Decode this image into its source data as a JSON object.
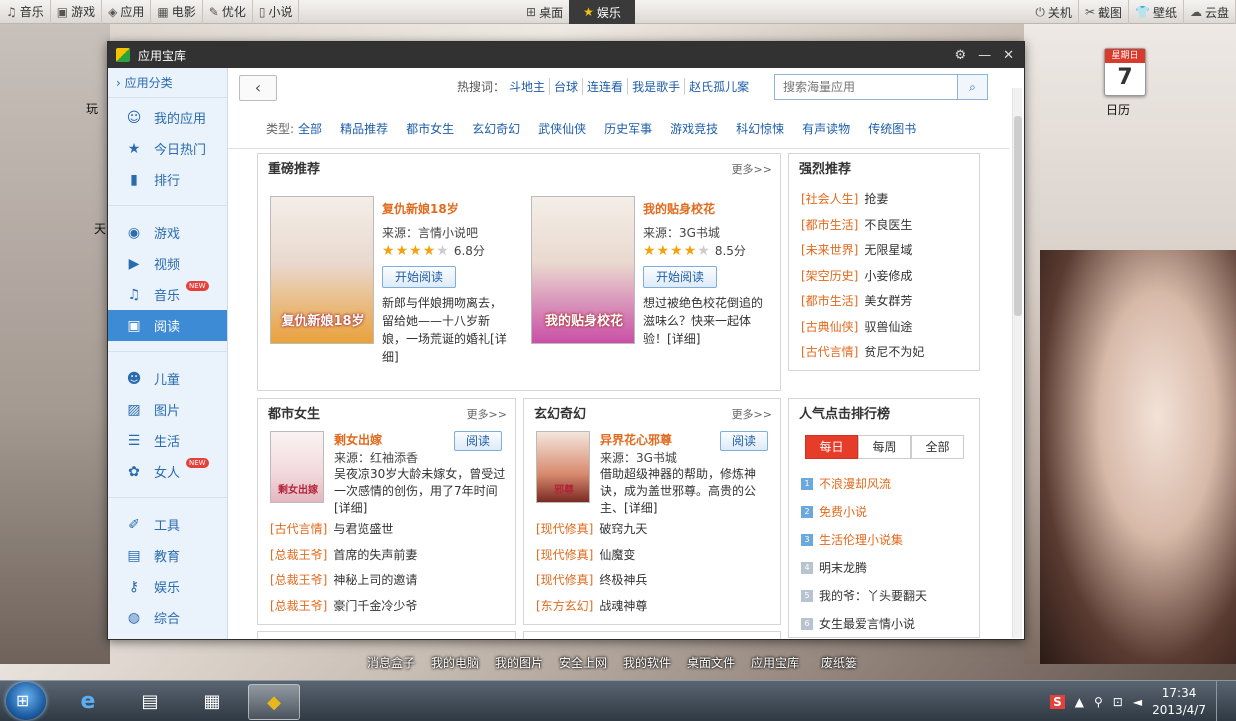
{
  "topbar": {
    "left": [
      {
        "icon": "music-icon",
        "glyph": "♫",
        "label": "音乐"
      },
      {
        "icon": "game-icon",
        "glyph": "▣",
        "label": "游戏"
      },
      {
        "icon": "app-icon",
        "glyph": "◈",
        "label": "应用"
      },
      {
        "icon": "film-icon",
        "glyph": "▦",
        "label": "电影"
      },
      {
        "icon": "optimize-icon",
        "glyph": "✎",
        "label": "优化"
      },
      {
        "icon": "book-icon",
        "glyph": "▯",
        "label": "小说"
      }
    ],
    "center": [
      {
        "icon": "desktop-icon",
        "glyph": "⊞",
        "label": "桌面"
      },
      {
        "icon": "star-icon",
        "glyph": "★",
        "label": "娱乐"
      }
    ],
    "right": [
      {
        "icon": "power-icon",
        "glyph": "⏻",
        "label": "关机"
      },
      {
        "icon": "screenshot-icon",
        "glyph": "✂",
        "label": "截图"
      },
      {
        "icon": "wallpaper-icon",
        "glyph": "👕",
        "label": "壁纸"
      },
      {
        "icon": "cloud-icon",
        "glyph": "☁",
        "label": "云盘"
      }
    ]
  },
  "desktop": {
    "calendar": {
      "weekday": "星期日",
      "day": "7",
      "label": "日历"
    },
    "left_labels": [
      "玩",
      "天"
    ]
  },
  "window": {
    "title": "应用宝库",
    "controls": {
      "settings": "⚙",
      "minimize": "—",
      "close": "✕"
    }
  },
  "sidebar": {
    "header": "应用分类",
    "items": [
      {
        "icon": "user-icon",
        "glyph": "☺",
        "label": "我的应用"
      },
      {
        "icon": "star-icon",
        "glyph": "★",
        "label": "今日热门"
      },
      {
        "icon": "bar-chart-icon",
        "glyph": "▮",
        "label": "排行"
      },
      {
        "icon": "gamepad-icon",
        "glyph": "◉",
        "label": "游戏"
      },
      {
        "icon": "video-icon",
        "glyph": "▶",
        "label": "视频"
      },
      {
        "icon": "music-note-icon",
        "glyph": "♫",
        "label": "音乐",
        "badge": "NEW"
      },
      {
        "icon": "book-open-icon",
        "glyph": "▣",
        "label": "阅读",
        "active": true
      },
      {
        "icon": "smile-icon",
        "glyph": "☻",
        "label": "儿童"
      },
      {
        "icon": "picture-icon",
        "glyph": "▨",
        "label": "图片"
      },
      {
        "icon": "list-icon",
        "glyph": "☰",
        "label": "生活"
      },
      {
        "icon": "flower-icon",
        "glyph": "✿",
        "label": "女人",
        "badge": "NEW"
      },
      {
        "icon": "pen-icon",
        "glyph": "✐",
        "label": "工具"
      },
      {
        "icon": "chart-line-icon",
        "glyph": "▤",
        "label": "教育"
      },
      {
        "icon": "key-icon",
        "glyph": "⚷",
        "label": "娱乐"
      },
      {
        "icon": "globe-icon",
        "glyph": "◍",
        "label": "综合"
      }
    ]
  },
  "toolbar": {
    "back": "‹",
    "hot_label": "热搜词：",
    "hot_words": [
      "斗地主",
      "台球",
      "连连看",
      "我是歌手",
      "赵氏孤儿案"
    ],
    "search_placeholder": "搜索海量应用",
    "search_icon": "⌕"
  },
  "types": {
    "label": "类型:",
    "items": [
      "全部",
      "精品推荐",
      "都市女生",
      "玄幻奇幻",
      "武侠仙侠",
      "历史军事",
      "游戏竞技",
      "科幻惊悚",
      "有声读物",
      "传统图书"
    ]
  },
  "featured": {
    "title": "重磅推荐",
    "more": "更多>>",
    "books": [
      {
        "title": "复仇新娘18岁",
        "source": "来源：言情小说吧",
        "stars_on": 3,
        "stars_half": 1,
        "score": "6.8分",
        "read": "开始阅读",
        "desc": "新郎与伴娘拥吻离去，留给她——十八岁新娘，一场荒诞的婚礼",
        "detail": "[详细]",
        "cover_text": "复仇新娘18岁",
        "cover_color": "#e9a13a"
      },
      {
        "title": "我的贴身校花",
        "source": "来源：3G书城",
        "stars_on": 4,
        "stars_half": 0,
        "score": "8.5分",
        "read": "开始阅读",
        "desc": "想过被绝色校花倒追的滋味么？快来一起体验！",
        "detail": "[详细]",
        "cover_text": "我的贴身校花",
        "cover_color": "#c94fa6"
      }
    ]
  },
  "strong": {
    "title": "强烈推荐",
    "items": [
      {
        "cat": "[社会人生]",
        "name": "抢妻"
      },
      {
        "cat": "[都市生活]",
        "name": "不良医生"
      },
      {
        "cat": "[未来世界]",
        "name": "无限星域"
      },
      {
        "cat": "[架空历史]",
        "name": "小妾修成"
      },
      {
        "cat": "[都市生活]",
        "name": "美女群芳"
      },
      {
        "cat": "[古典仙侠]",
        "name": "驭兽仙途"
      },
      {
        "cat": "[古代言情]",
        "name": "贫尼不为妃"
      }
    ]
  },
  "urban": {
    "title": "都市女生",
    "more": "更多>>",
    "book": {
      "title": "剩女出嫁",
      "source": "来源：红袖添香",
      "read": "阅读",
      "desc": "吴夜凉30岁大龄未嫁女，曾受过一次感情的创伤，用了7年时间",
      "detail": "[详细]",
      "cover_text": "剩女出嫁"
    },
    "items": [
      {
        "cat": "[古代言情]",
        "name": "与君览盛世"
      },
      {
        "cat": "[总裁王爷]",
        "name": "首席的失声前妻"
      },
      {
        "cat": "[总裁王爷]",
        "name": "神秘上司的邀请"
      },
      {
        "cat": "[总裁王爷]",
        "name": "豪门千金冷少爷"
      }
    ]
  },
  "fantasy": {
    "title": "玄幻奇幻",
    "more": "更多>>",
    "book": {
      "title": "异界花心邪尊",
      "source": "来源：3G书城",
      "read": "阅读",
      "desc": "借助超级神器的帮助，修炼神诀，成为盖世邪尊。高贵的公主、",
      "detail": "[详细]",
      "cover_text": "邪尊"
    },
    "items": [
      {
        "cat": "[现代修真]",
        "name": "破窍九天"
      },
      {
        "cat": "[现代修真]",
        "name": "仙魔变"
      },
      {
        "cat": "[现代修真]",
        "name": "终极神兵"
      },
      {
        "cat": "[东方玄幻]",
        "name": "战魂神尊"
      }
    ]
  },
  "ranking": {
    "title": "人气点击排行榜",
    "tabs": [
      "每日",
      "每周",
      "全部"
    ],
    "items": [
      {
        "n": "1",
        "name": "不浪漫却风流"
      },
      {
        "n": "2",
        "name": "免费小说"
      },
      {
        "n": "3",
        "name": "生活伦理小说集"
      },
      {
        "n": "4",
        "name": "明末龙腾"
      },
      {
        "n": "5",
        "name": "我的爷：丫头要翻天"
      },
      {
        "n": "6",
        "name": "女生最爱言情小说"
      }
    ]
  },
  "dock": [
    "消息盒子",
    "我的电脑",
    "我的图片",
    "安全上网",
    "我的软件",
    "桌面文件",
    "应用宝库",
    "废纸篓"
  ],
  "taskbar": {
    "time": "17:34",
    "date": "2013/4/7",
    "apps": [
      {
        "icon": "ie-icon",
        "glyph": "e"
      },
      {
        "icon": "folder-icon",
        "glyph": "▤"
      },
      {
        "icon": "control-panel-icon",
        "glyph": "▦"
      },
      {
        "icon": "app-store-icon",
        "glyph": "◆"
      }
    ],
    "tray": [
      {
        "icon": "sogou-icon",
        "glyph": "S"
      },
      {
        "icon": "arrow-up-icon",
        "glyph": "▲"
      },
      {
        "icon": "mic-icon",
        "glyph": "⚲"
      },
      {
        "icon": "network-icon",
        "glyph": "⊡"
      },
      {
        "icon": "volume-icon",
        "glyph": "◄"
      }
    ]
  }
}
